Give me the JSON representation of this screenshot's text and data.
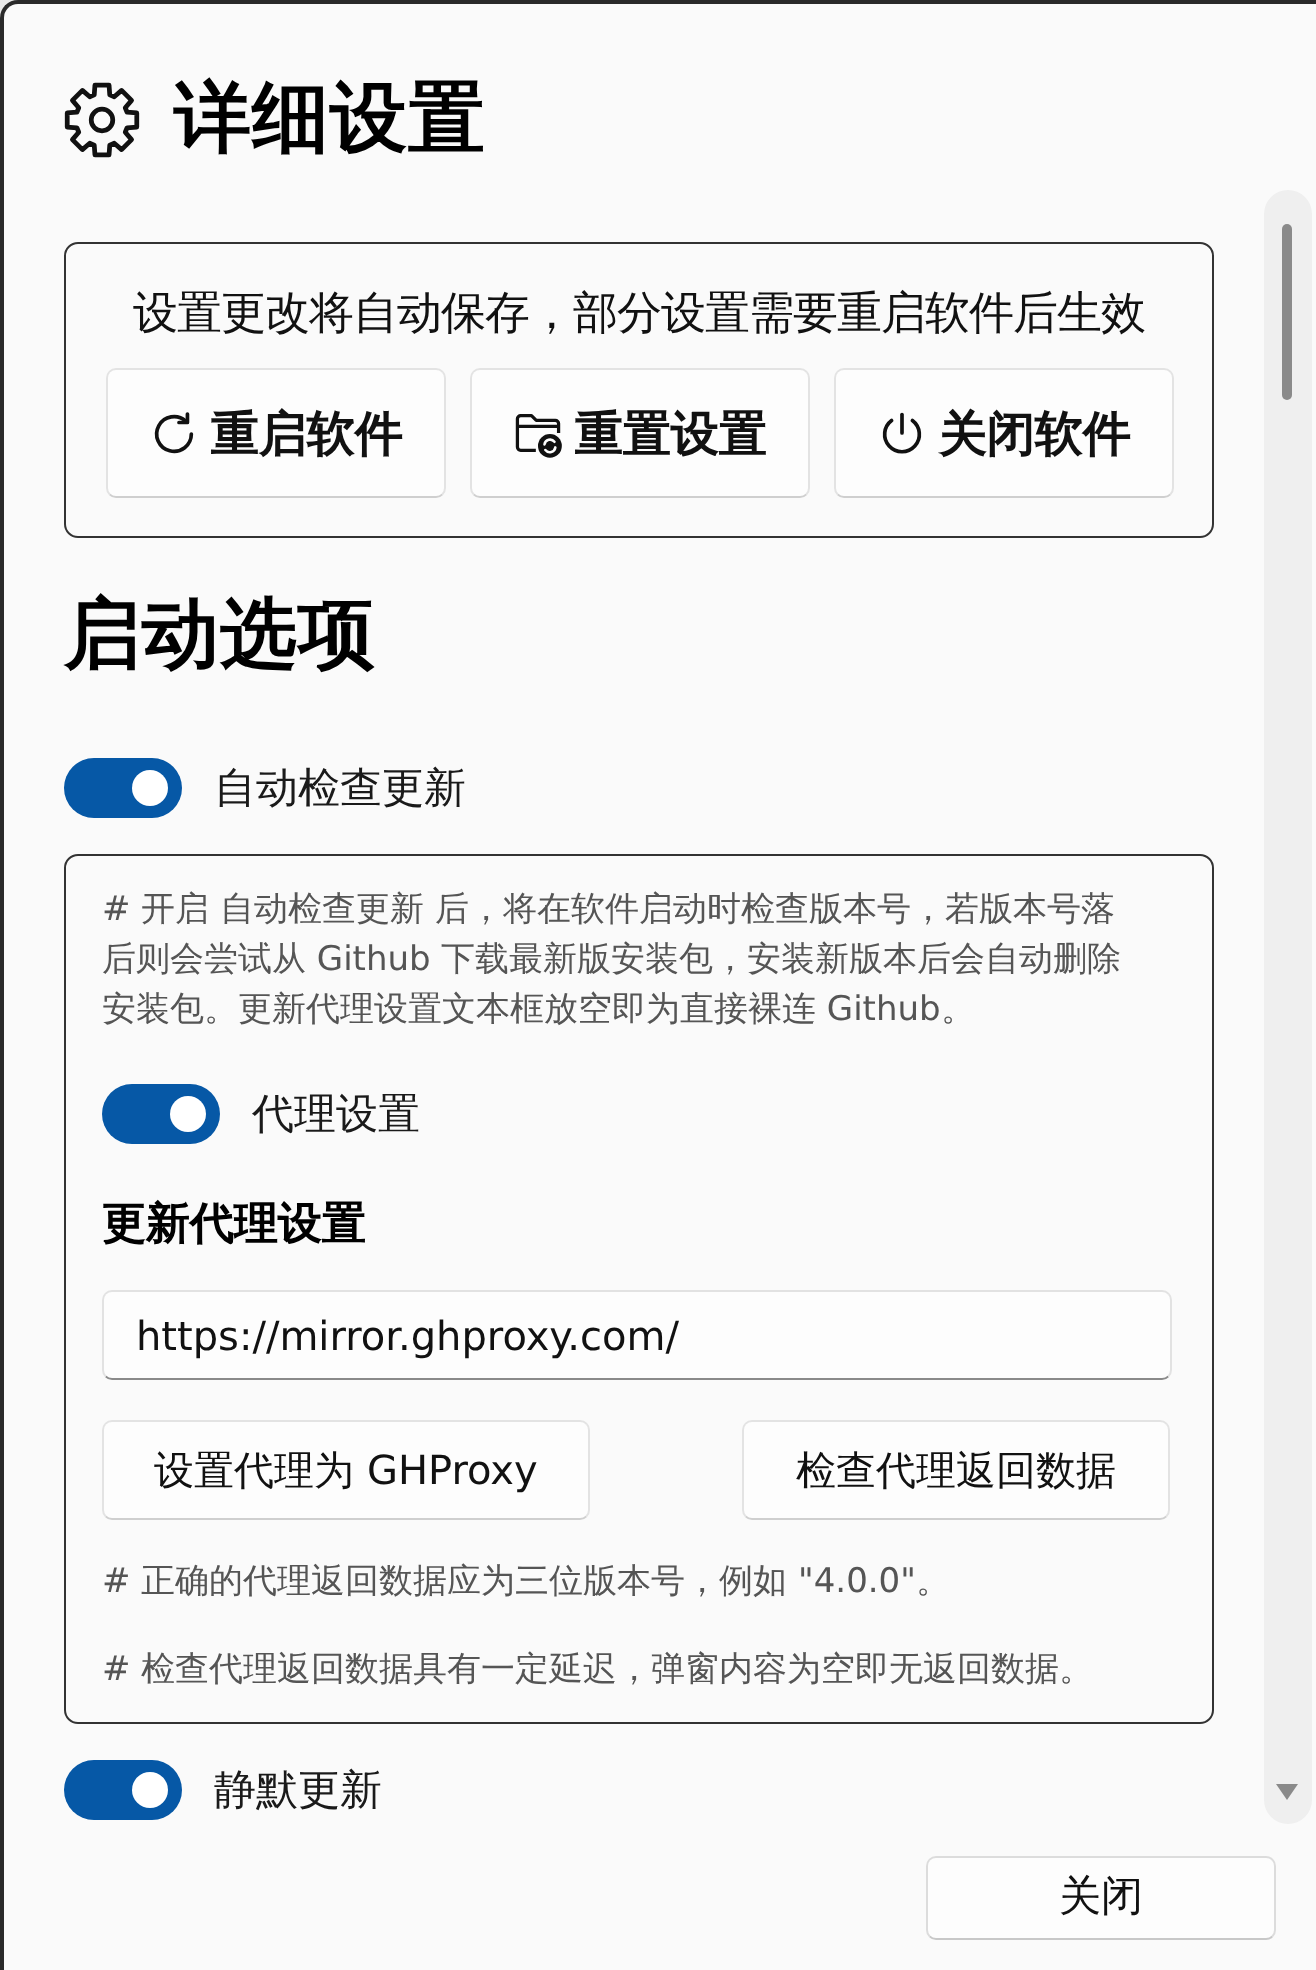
{
  "dialog": {
    "title": "详细设置"
  },
  "notice": {
    "text": "设置更改将自动保存，部分设置需要重启软件后生效",
    "buttons": [
      "重启软件",
      "重置设置",
      "关闭软件"
    ]
  },
  "startup": {
    "heading": "启动选项",
    "auto_update": {
      "label": "自动检查更新",
      "on": true
    },
    "update_panel": {
      "description": "# 开启 自动检查更新 后，将在软件启动时检查版本号，若版本号落后则会尝试从 Github 下载最新版安装包，安装新版本后会自动删除安装包。更新代理设置文本框放空即为直接裸连 Github。",
      "proxy_toggle": {
        "label": "代理设置",
        "on": true
      },
      "proxy_heading": "更新代理设置",
      "proxy_field": {
        "value": "https://mirror.ghproxy.com/"
      },
      "buttons": [
        "设置代理为 GHProxy",
        "检查代理返回数据"
      ],
      "notes": [
        "# 正确的代理返回数据应为三位版本号，例如 \"4.0.0\"。",
        "# 检查代理返回数据具有一定延迟，弹窗内容为空即无返回数据。"
      ]
    },
    "silent_update": {
      "label": "静默更新",
      "on": true
    }
  },
  "footer": {
    "close_button": "关闭"
  }
}
